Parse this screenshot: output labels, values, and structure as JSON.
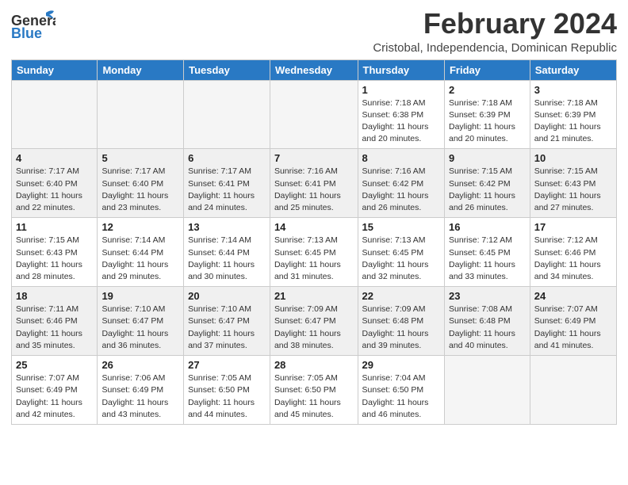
{
  "logo": {
    "line1": "General",
    "line2": "Blue"
  },
  "title": "February 2024",
  "subtitle": "Cristobal, Independencia, Dominican Republic",
  "days_header": [
    "Sunday",
    "Monday",
    "Tuesday",
    "Wednesday",
    "Thursday",
    "Friday",
    "Saturday"
  ],
  "weeks": [
    [
      {
        "day": "",
        "info": ""
      },
      {
        "day": "",
        "info": ""
      },
      {
        "day": "",
        "info": ""
      },
      {
        "day": "",
        "info": ""
      },
      {
        "day": "1",
        "info": "Sunrise: 7:18 AM\nSunset: 6:38 PM\nDaylight: 11 hours\nand 20 minutes."
      },
      {
        "day": "2",
        "info": "Sunrise: 7:18 AM\nSunset: 6:39 PM\nDaylight: 11 hours\nand 20 minutes."
      },
      {
        "day": "3",
        "info": "Sunrise: 7:18 AM\nSunset: 6:39 PM\nDaylight: 11 hours\nand 21 minutes."
      }
    ],
    [
      {
        "day": "4",
        "info": "Sunrise: 7:17 AM\nSunset: 6:40 PM\nDaylight: 11 hours\nand 22 minutes."
      },
      {
        "day": "5",
        "info": "Sunrise: 7:17 AM\nSunset: 6:40 PM\nDaylight: 11 hours\nand 23 minutes."
      },
      {
        "day": "6",
        "info": "Sunrise: 7:17 AM\nSunset: 6:41 PM\nDaylight: 11 hours\nand 24 minutes."
      },
      {
        "day": "7",
        "info": "Sunrise: 7:16 AM\nSunset: 6:41 PM\nDaylight: 11 hours\nand 25 minutes."
      },
      {
        "day": "8",
        "info": "Sunrise: 7:16 AM\nSunset: 6:42 PM\nDaylight: 11 hours\nand 26 minutes."
      },
      {
        "day": "9",
        "info": "Sunrise: 7:15 AM\nSunset: 6:42 PM\nDaylight: 11 hours\nand 26 minutes."
      },
      {
        "day": "10",
        "info": "Sunrise: 7:15 AM\nSunset: 6:43 PM\nDaylight: 11 hours\nand 27 minutes."
      }
    ],
    [
      {
        "day": "11",
        "info": "Sunrise: 7:15 AM\nSunset: 6:43 PM\nDaylight: 11 hours\nand 28 minutes."
      },
      {
        "day": "12",
        "info": "Sunrise: 7:14 AM\nSunset: 6:44 PM\nDaylight: 11 hours\nand 29 minutes."
      },
      {
        "day": "13",
        "info": "Sunrise: 7:14 AM\nSunset: 6:44 PM\nDaylight: 11 hours\nand 30 minutes."
      },
      {
        "day": "14",
        "info": "Sunrise: 7:13 AM\nSunset: 6:45 PM\nDaylight: 11 hours\nand 31 minutes."
      },
      {
        "day": "15",
        "info": "Sunrise: 7:13 AM\nSunset: 6:45 PM\nDaylight: 11 hours\nand 32 minutes."
      },
      {
        "day": "16",
        "info": "Sunrise: 7:12 AM\nSunset: 6:45 PM\nDaylight: 11 hours\nand 33 minutes."
      },
      {
        "day": "17",
        "info": "Sunrise: 7:12 AM\nSunset: 6:46 PM\nDaylight: 11 hours\nand 34 minutes."
      }
    ],
    [
      {
        "day": "18",
        "info": "Sunrise: 7:11 AM\nSunset: 6:46 PM\nDaylight: 11 hours\nand 35 minutes."
      },
      {
        "day": "19",
        "info": "Sunrise: 7:10 AM\nSunset: 6:47 PM\nDaylight: 11 hours\nand 36 minutes."
      },
      {
        "day": "20",
        "info": "Sunrise: 7:10 AM\nSunset: 6:47 PM\nDaylight: 11 hours\nand 37 minutes."
      },
      {
        "day": "21",
        "info": "Sunrise: 7:09 AM\nSunset: 6:47 PM\nDaylight: 11 hours\nand 38 minutes."
      },
      {
        "day": "22",
        "info": "Sunrise: 7:09 AM\nSunset: 6:48 PM\nDaylight: 11 hours\nand 39 minutes."
      },
      {
        "day": "23",
        "info": "Sunrise: 7:08 AM\nSunset: 6:48 PM\nDaylight: 11 hours\nand 40 minutes."
      },
      {
        "day": "24",
        "info": "Sunrise: 7:07 AM\nSunset: 6:49 PM\nDaylight: 11 hours\nand 41 minutes."
      }
    ],
    [
      {
        "day": "25",
        "info": "Sunrise: 7:07 AM\nSunset: 6:49 PM\nDaylight: 11 hours\nand 42 minutes."
      },
      {
        "day": "26",
        "info": "Sunrise: 7:06 AM\nSunset: 6:49 PM\nDaylight: 11 hours\nand 43 minutes."
      },
      {
        "day": "27",
        "info": "Sunrise: 7:05 AM\nSunset: 6:50 PM\nDaylight: 11 hours\nand 44 minutes."
      },
      {
        "day": "28",
        "info": "Sunrise: 7:05 AM\nSunset: 6:50 PM\nDaylight: 11 hours\nand 45 minutes."
      },
      {
        "day": "29",
        "info": "Sunrise: 7:04 AM\nSunset: 6:50 PM\nDaylight: 11 hours\nand 46 minutes."
      },
      {
        "day": "",
        "info": ""
      },
      {
        "day": "",
        "info": ""
      }
    ]
  ]
}
